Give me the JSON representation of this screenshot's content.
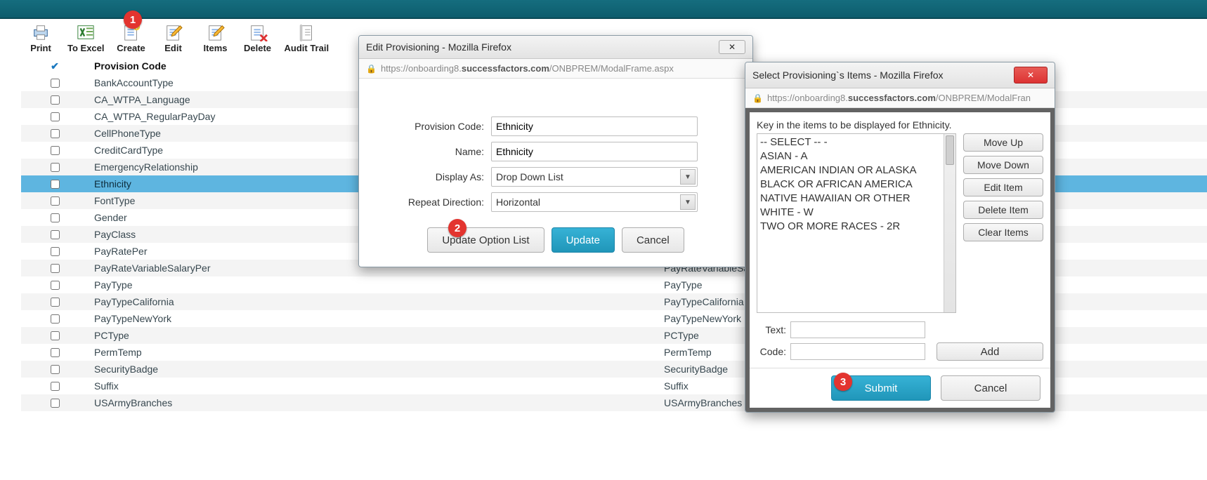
{
  "toolbar": {
    "print": "Print",
    "to_excel": "To Excel",
    "create": "Create",
    "edit": "Edit",
    "items": "Items",
    "delete": "Delete",
    "audit": "Audit Trail"
  },
  "annotations": {
    "step1": "1",
    "step2": "2",
    "step3": "3"
  },
  "table": {
    "header_label": "Provision Code",
    "rows": [
      {
        "code": "BankAccountType",
        "code2": ""
      },
      {
        "code": "CA_WTPA_Language",
        "code2": ""
      },
      {
        "code": "CA_WTPA_RegularPayDay",
        "code2": ""
      },
      {
        "code": "CellPhoneType",
        "code2": ""
      },
      {
        "code": "CreditCardType",
        "code2": ""
      },
      {
        "code": "EmergencyRelationship",
        "code2": ""
      },
      {
        "code": "Ethnicity",
        "code2": "",
        "selected": true
      },
      {
        "code": "FontType",
        "code2": ""
      },
      {
        "code": "Gender",
        "code2": ""
      },
      {
        "code": "PayClass",
        "code2": ""
      },
      {
        "code": "PayRatePer",
        "code2": ""
      },
      {
        "code": "PayRateVariableSalaryPer",
        "code2": "PayRateVariableSalaryPer"
      },
      {
        "code": "PayType",
        "code2": "PayType"
      },
      {
        "code": "PayTypeCalifornia",
        "code2": "PayTypeCalifornia"
      },
      {
        "code": "PayTypeNewYork",
        "code2": "PayTypeNewYork"
      },
      {
        "code": "PCType",
        "code2": "PCType"
      },
      {
        "code": "PermTemp",
        "code2": "PermTemp"
      },
      {
        "code": "SecurityBadge",
        "code2": "SecurityBadge"
      },
      {
        "code": "Suffix",
        "code2": "Suffix"
      },
      {
        "code": "USArmyBranches",
        "code2": "USArmyBranches"
      }
    ]
  },
  "edit_dialog": {
    "title": "Edit Provisioning - Mozilla Firefox",
    "url_host": "successfactors.com",
    "url_pre": "https://onboarding8.",
    "url_post": "/ONBPREM/ModalFrame.aspx",
    "labels": {
      "provision_code": "Provision Code:",
      "name": "Name:",
      "display_as": "Display As:",
      "repeat": "Repeat Direction:"
    },
    "values": {
      "provision_code": "Ethnicity",
      "name": "Ethnicity",
      "display_as": "Drop Down List",
      "repeat": "Horizontal"
    },
    "buttons": {
      "update_options": "Update Option List",
      "update": "Update",
      "cancel": "Cancel"
    }
  },
  "items_dialog": {
    "title": "Select Provisioning`s Items - Mozilla Firefox",
    "url_host": "successfactors.com",
    "url_pre": "https://onboarding8.",
    "url_post": "/ONBPREM/ModalFran",
    "instruction": "Key in the items to be displayed for Ethnicity.",
    "items": [
      "-- SELECT -- -",
      "ASIAN - A",
      "AMERICAN INDIAN OR ALASKA",
      "BLACK OR AFRICAN AMERICA",
      "NATIVE HAWAIIAN OR OTHER",
      "WHITE - W",
      "TWO OR MORE RACES - 2R"
    ],
    "side_buttons": {
      "move_up": "Move Up",
      "move_down": "Move Down",
      "edit": "Edit Item",
      "delete": "Delete Item",
      "clear": "Clear Items"
    },
    "text_label": "Text:",
    "code_label": "Code:",
    "add": "Add",
    "submit": "Submit",
    "cancel": "Cancel"
  }
}
